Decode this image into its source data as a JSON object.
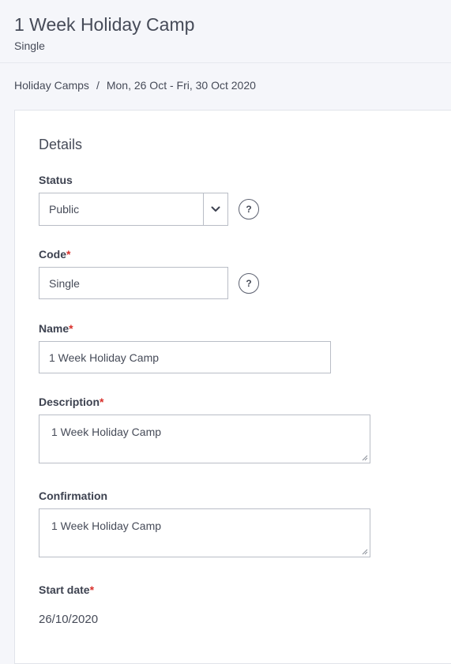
{
  "header": {
    "title": "1 Week Holiday Camp",
    "subtitle": "Single"
  },
  "breadcrumb": {
    "parent": "Holiday Camps",
    "separator": "/",
    "current": "Mon, 26 Oct - Fri, 30 Oct 2020"
  },
  "details": {
    "section_title": "Details",
    "required_marker": "*",
    "help_symbol": "?",
    "status": {
      "label": "Status",
      "value": "Public"
    },
    "code": {
      "label": "Code",
      "value": "Single"
    },
    "name": {
      "label": "Name",
      "value": "1 Week Holiday Camp"
    },
    "description": {
      "label": "Description",
      "value": "1 Week Holiday Camp"
    },
    "confirmation": {
      "label": "Confirmation",
      "value": "1 Week Holiday Camp"
    },
    "start_date": {
      "label": "Start date",
      "value": "26/10/2020"
    }
  },
  "icons": {
    "select_chevron": "chevron-down-icon",
    "help": "help-circle-icon",
    "resize": "resize-grip-icon"
  },
  "colors": {
    "required": "#d9302b",
    "page_background": "#f5f6fa",
    "card_background": "#ffffff",
    "text": "#464b58"
  }
}
